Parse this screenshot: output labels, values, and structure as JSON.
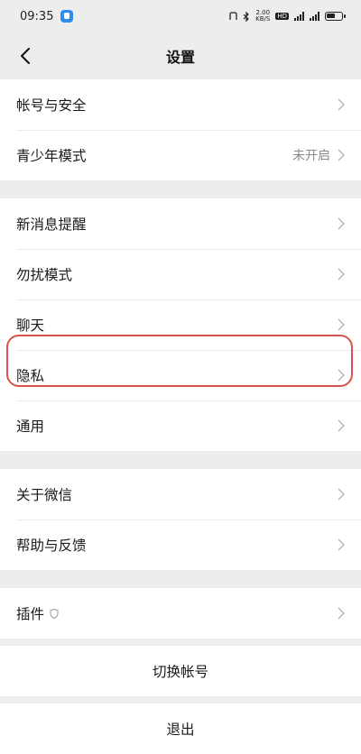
{
  "status_bar": {
    "time": "09:35",
    "net_speed": "2.00\nKB/S"
  },
  "nav": {
    "title": "设置"
  },
  "groups": [
    {
      "items": [
        {
          "label": "帐号与安全",
          "value": ""
        },
        {
          "label": "青少年模式",
          "value": "未开启"
        }
      ]
    },
    {
      "items": [
        {
          "label": "新消息提醒",
          "value": ""
        },
        {
          "label": "勿扰模式",
          "value": ""
        },
        {
          "label": "聊天",
          "value": ""
        },
        {
          "label": "隐私",
          "value": ""
        },
        {
          "label": "通用",
          "value": ""
        }
      ]
    },
    {
      "items": [
        {
          "label": "关于微信",
          "value": ""
        },
        {
          "label": "帮助与反馈",
          "value": ""
        }
      ]
    },
    {
      "items": [
        {
          "label": "插件",
          "value": "",
          "icon": "shield-icon"
        }
      ]
    }
  ],
  "actions": {
    "switch_account": "切换帐号",
    "logout": "退出"
  },
  "colors": {
    "background": "#ededed",
    "highlight": "#d9534f"
  }
}
